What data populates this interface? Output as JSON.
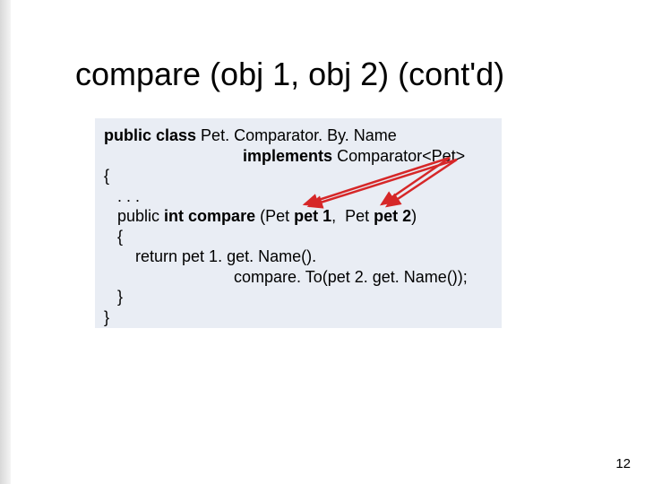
{
  "title": "compare (obj 1, obj 2) (cont'd)",
  "code": {
    "l1a": "public class",
    "l1b": " Pet. Comparator. By. Name",
    "l2a": "                               implements",
    "l2b": " Comparator<Pet>",
    "l3": "{",
    "l4": "   . . .",
    "l5a": "   public ",
    "l5b": "int",
    "l5c": " compare",
    "l5d": " (Pet ",
    "l5e": "pet 1",
    "l5f": ",  Pet ",
    "l5g": "pet 2",
    "l5h": ")",
    "l6": "   {",
    "l7a": "       return ",
    "l7b": "pet 1. get. Name().",
    "l8": "                             compare. To(pet 2. get. Name());",
    "l9": "   }",
    "l10": "}"
  },
  "page_number": "12",
  "arrow_color": "#d62728"
}
